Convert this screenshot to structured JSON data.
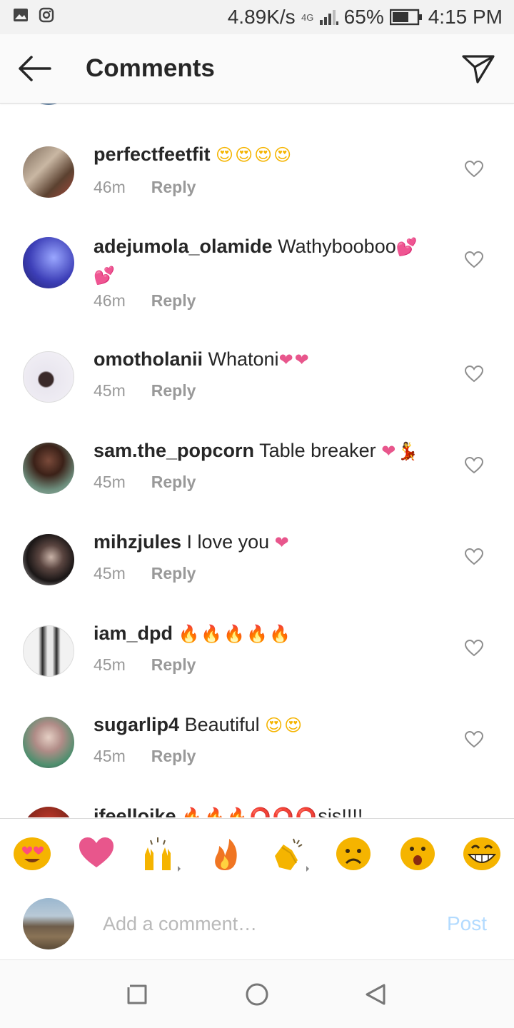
{
  "status_bar": {
    "speed": "4.89K/s",
    "network": "4G",
    "battery": "65%",
    "time": "4:15 PM",
    "icons": [
      "gallery-icon",
      "instagram-icon",
      "signal-icon",
      "battery-icon"
    ]
  },
  "header": {
    "title": "Comments",
    "back_icon": "arrow-left-icon",
    "share_icon": "paper-plane-icon"
  },
  "comments": [
    {
      "username": "perfectfeetfit",
      "text": "",
      "emoji": "😍😍😍😍",
      "time": "46m",
      "reply": "Reply"
    },
    {
      "username": "adejumola_olamide",
      "text": "Wathybooboo",
      "emoji": "💕💕",
      "time": "46m",
      "reply": "Reply"
    },
    {
      "username": "omotholanii",
      "text": "Whatoni",
      "emoji": "❤❤",
      "time": "45m",
      "reply": "Reply"
    },
    {
      "username": "sam.the_popcorn",
      "text": "Table breaker",
      "emoji": "❤💃",
      "time": "45m",
      "reply": "Reply"
    },
    {
      "username": "mihzjules",
      "text": "I love you",
      "emoji": "❤",
      "time": "45m",
      "reply": "Reply"
    },
    {
      "username": "iam_dpd",
      "text": "",
      "emoji": "🔥🔥🔥🔥🔥",
      "time": "45m",
      "reply": "Reply"
    },
    {
      "username": "sugarlip4",
      "text": "Beautiful",
      "emoji": "😍😍",
      "time": "45m",
      "reply": "Reply"
    },
    {
      "username": "ifeelloike",
      "text": "sis!!!!",
      "emoji": "🔥🔥🔥⭕⭕⭕",
      "time": "",
      "reply": ""
    }
  ],
  "quick_emojis": [
    "😍",
    "❤️",
    "🙌",
    "🔥",
    "👏",
    "😢",
    "😮",
    "😂"
  ],
  "composer": {
    "placeholder": "Add a comment…",
    "post_label": "Post"
  },
  "nav_bar": [
    "recents-icon",
    "home-icon",
    "back-icon"
  ],
  "colors": {
    "post_disabled": "#b3dbff",
    "heart_emoji": "#e8568c",
    "secondary_text": "#999999"
  }
}
